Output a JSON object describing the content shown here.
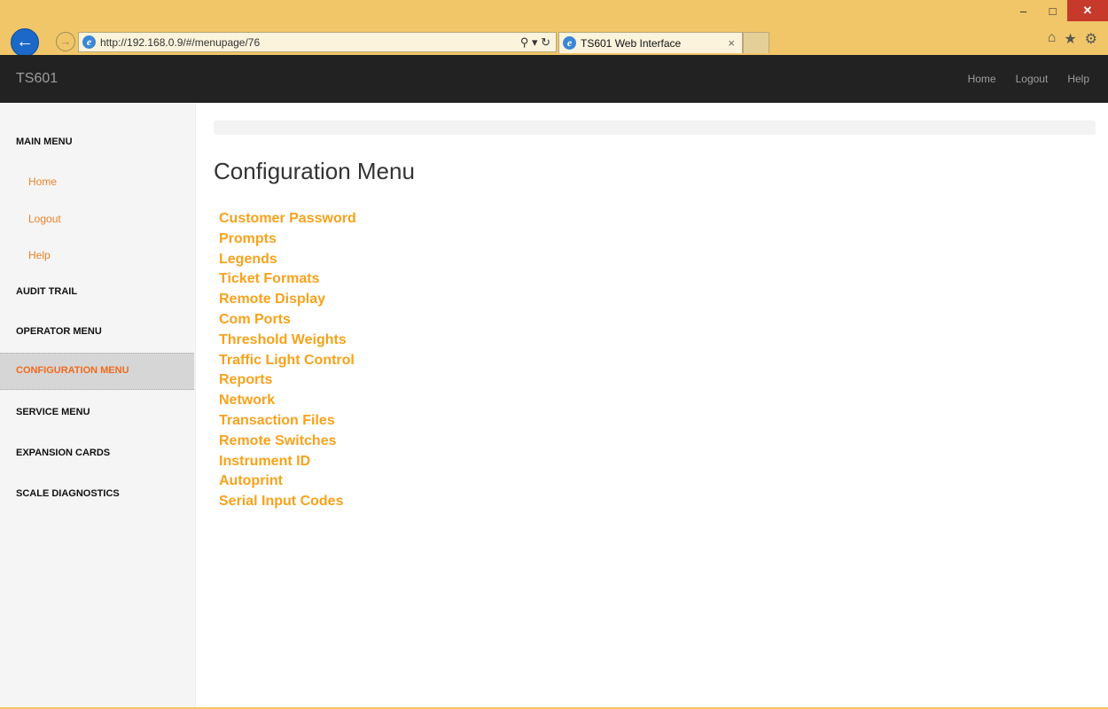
{
  "browser": {
    "url": "http://192.168.0.9/#/menupage/76",
    "tab_title": "TS601 Web Interface",
    "tab_close": "×"
  },
  "navbar": {
    "brand": "TS601",
    "links": [
      "Home",
      "Logout",
      "Help"
    ]
  },
  "sidebar": {
    "main_menu": "MAIN MENU",
    "main_links": [
      "Home",
      "Logout",
      "Help"
    ],
    "sections": [
      "AUDIT TRAIL",
      "OPERATOR MENU",
      "CONFIGURATION MENU",
      "SERVICE MENU",
      "EXPANSION CARDS",
      "SCALE DIAGNOSTICS"
    ]
  },
  "main": {
    "title": "Configuration Menu",
    "items": [
      "Customer Password",
      "Prompts",
      "Legends",
      "Ticket Formats",
      "Remote Display",
      "Com Ports",
      "Threshold Weights",
      "Traffic Light Control",
      "Reports",
      "Network",
      "Transaction Files",
      "Remote Switches",
      "Instrument ID",
      "Autoprint",
      "Serial Input Codes"
    ]
  },
  "icons": {
    "back": "arrow-left-icon",
    "forward": "arrow-right-icon",
    "ie": "ie-icon",
    "home": "home-icon",
    "favorites": "star-icon",
    "settings": "gear-icon"
  },
  "colors": {
    "accent_link": "#f7a21b",
    "active_section": "#f26a1b",
    "navbar_bg": "#222222",
    "chrome_bg": "#f0c669"
  }
}
